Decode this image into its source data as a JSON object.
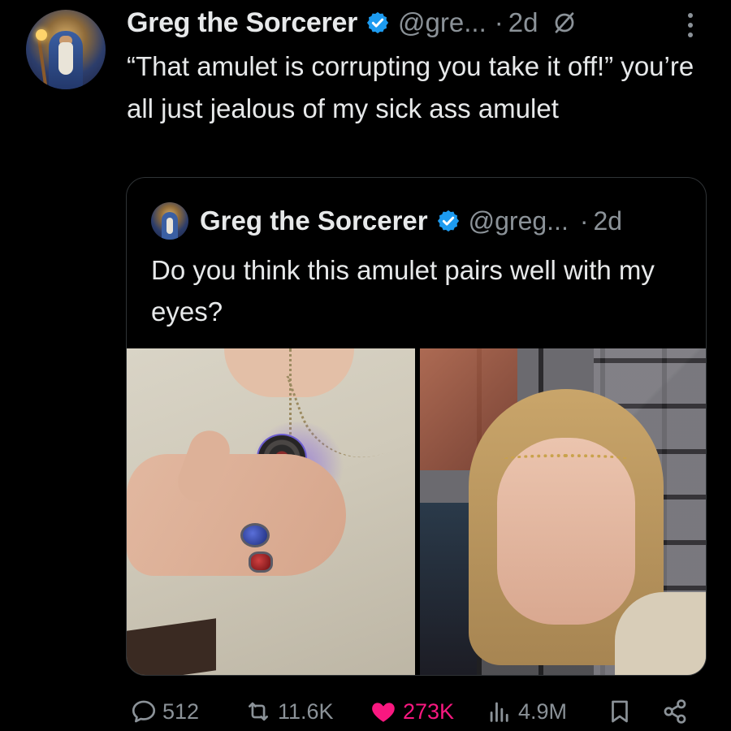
{
  "tweet": {
    "display_name": "Greg the Sorcerer",
    "handle": "@gre...",
    "separator": "·",
    "time": "2d",
    "text": "“That amulet is corrupting you take it off!” you’re all just jealous of my sick ass amulet",
    "verified": true
  },
  "quoted_tweet": {
    "display_name": "Greg the Sorcerer",
    "handle": "@greg...",
    "separator": "·",
    "time": "2d",
    "text": "Do you think this amulet pairs well with my eyes?",
    "verified": true
  },
  "actions": {
    "replies": "512",
    "retweets": "11.6K",
    "likes": "273K",
    "views": "4.9M"
  },
  "icons": [
    "avatar",
    "verified-badge-icon",
    "grok-icon",
    "more-options-icon",
    "reply-icon",
    "retweet-icon",
    "heart-icon",
    "views-icon",
    "bookmark-icon",
    "share-icon"
  ],
  "colors": {
    "background": "#000000",
    "text": "#e7e9ea",
    "secondary": "#8b9298",
    "verified": "#1d9bf0",
    "like": "#f91880",
    "border": "#2f3336"
  }
}
